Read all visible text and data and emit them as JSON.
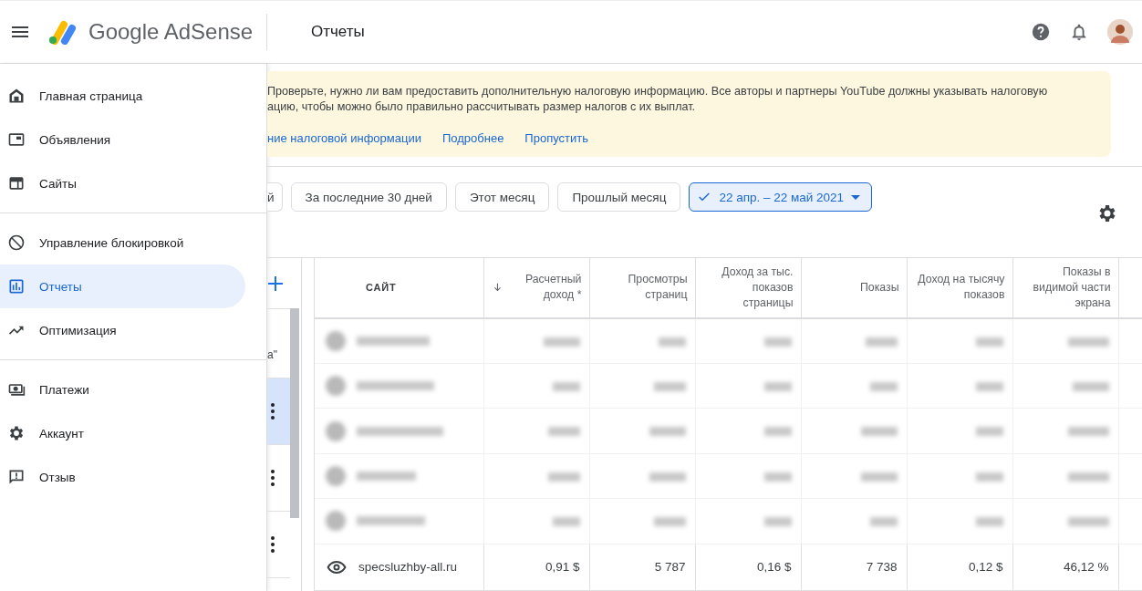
{
  "header": {
    "brand": "Google AdSense",
    "page_title": "Отчеты"
  },
  "sidebar": {
    "groups": [
      [
        {
          "label": "Главная страница",
          "selected": false
        },
        {
          "label": "Объявления",
          "selected": false
        },
        {
          "label": "Сайты",
          "selected": false
        }
      ],
      [
        {
          "label": "Управление блокировкой",
          "selected": false
        },
        {
          "label": "Отчеты",
          "selected": true
        },
        {
          "label": "Оптимизация",
          "selected": false
        }
      ],
      [
        {
          "label": "Платежи",
          "selected": false
        },
        {
          "label": "Аккаунт",
          "selected": false
        },
        {
          "label": "Отзыв",
          "selected": false
        }
      ]
    ]
  },
  "banner": {
    "lines": [
      "Проверьте, нужно ли вам предоставить дополнительную налоговую информацию. Все авторы и партнеры YouTube должны указывать налоговую",
      "ацию, чтобы можно было правильно рассчитывать размер налогов с их выплат."
    ],
    "links": [
      "ние налоговой информации",
      "Подробнее",
      "Пропустить"
    ]
  },
  "date_chips": [
    {
      "label": "й",
      "selected": false,
      "kind": "preset"
    },
    {
      "label": "За последние 30 дней",
      "selected": false,
      "kind": "preset"
    },
    {
      "label": "Этот месяц",
      "selected": false,
      "kind": "preset"
    },
    {
      "label": "Прошлый месяц",
      "selected": false,
      "kind": "preset"
    },
    {
      "label": "22 апр. – 22 май 2021",
      "selected": true,
      "kind": "range"
    }
  ],
  "side_list": {
    "caption": "а\"",
    "rows": [
      {
        "selected": true
      },
      {
        "selected": false
      },
      {
        "selected": false
      }
    ]
  },
  "table": {
    "columns": [
      {
        "label": "САЙТ",
        "sorted": false
      },
      {
        "label": "Расчетный доход *",
        "sorted": true
      },
      {
        "label": "Просмотры страниц",
        "sorted": false
      },
      {
        "label": "Доход за тыс. показов страницы",
        "sorted": false
      },
      {
        "label": "Показы",
        "sorted": false
      },
      {
        "label": "Доход на тысячу показов",
        "sorted": false
      },
      {
        "label": "Показы в видимой части экрана",
        "sorted": false
      }
    ],
    "rows": [
      {
        "kind": "blurred"
      },
      {
        "kind": "blurred"
      },
      {
        "kind": "blurred"
      },
      {
        "kind": "blurred"
      },
      {
        "kind": "blurred"
      },
      {
        "kind": "data",
        "cells": [
          "specsluzhby-all.ru",
          "0,91 $",
          "5 787",
          "0,16 $",
          "7 738",
          "0,12 $",
          "46,12 %"
        ]
      }
    ]
  }
}
